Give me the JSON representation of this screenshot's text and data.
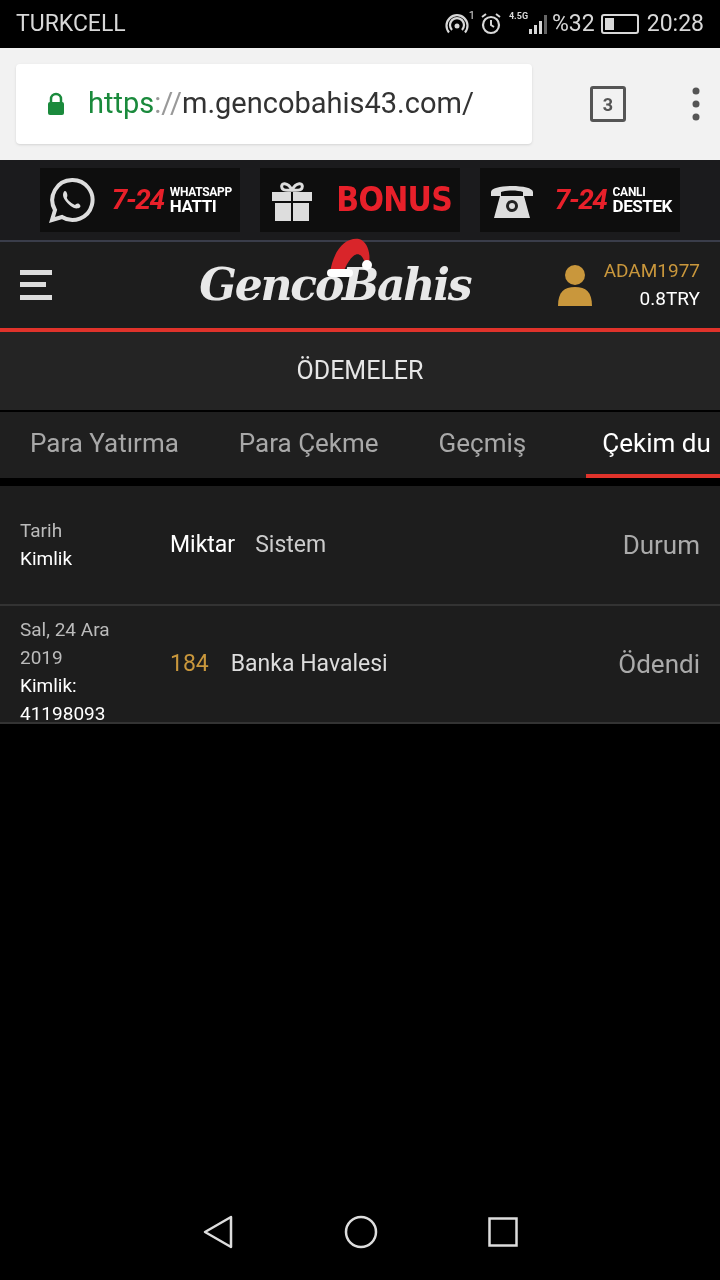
{
  "status_bar": {
    "carrier": "TURKCELL",
    "hotspot_count": "1",
    "network": "4.5G",
    "battery": "%32",
    "time": "20:28"
  },
  "browser": {
    "url_scheme": "https",
    "url_separator": "://",
    "url_host": "m.gencobahis43.com/",
    "secure": true,
    "tab_count": "3"
  },
  "banners": [
    {
      "kind": "whatsapp",
      "number": "7-24",
      "line_1": "WHATSAPP",
      "line_2": "HATTI"
    },
    {
      "kind": "gift",
      "title": "BONUS"
    },
    {
      "kind": "phone",
      "number": "7-24",
      "line_1": "CANLI",
      "line_2": "DESTEK"
    }
  ],
  "header": {
    "logo": "GencoBahis",
    "username": "ADAM1977",
    "balance": "0.8TRY"
  },
  "page_title": "ÖDEMELER",
  "tabs": [
    {
      "label": "Para Yatırma",
      "selected": false
    },
    {
      "label": "Para Çekme",
      "selected": false
    },
    {
      "label": "Geçmiş",
      "selected": false
    },
    {
      "label": "Çekim du",
      "selected": true
    }
  ],
  "table": {
    "columns": {
      "date": "Tarih",
      "id": "Kimlik",
      "amount": "Miktar",
      "system": "Sistem",
      "status": "Durum"
    },
    "rows": [
      {
        "date": "Sal, 24 Ara 2019",
        "id": "Kimlik: 41198093",
        "amount": "184",
        "system": "Banka Havalesi",
        "status": "Ödendi"
      }
    ]
  }
}
